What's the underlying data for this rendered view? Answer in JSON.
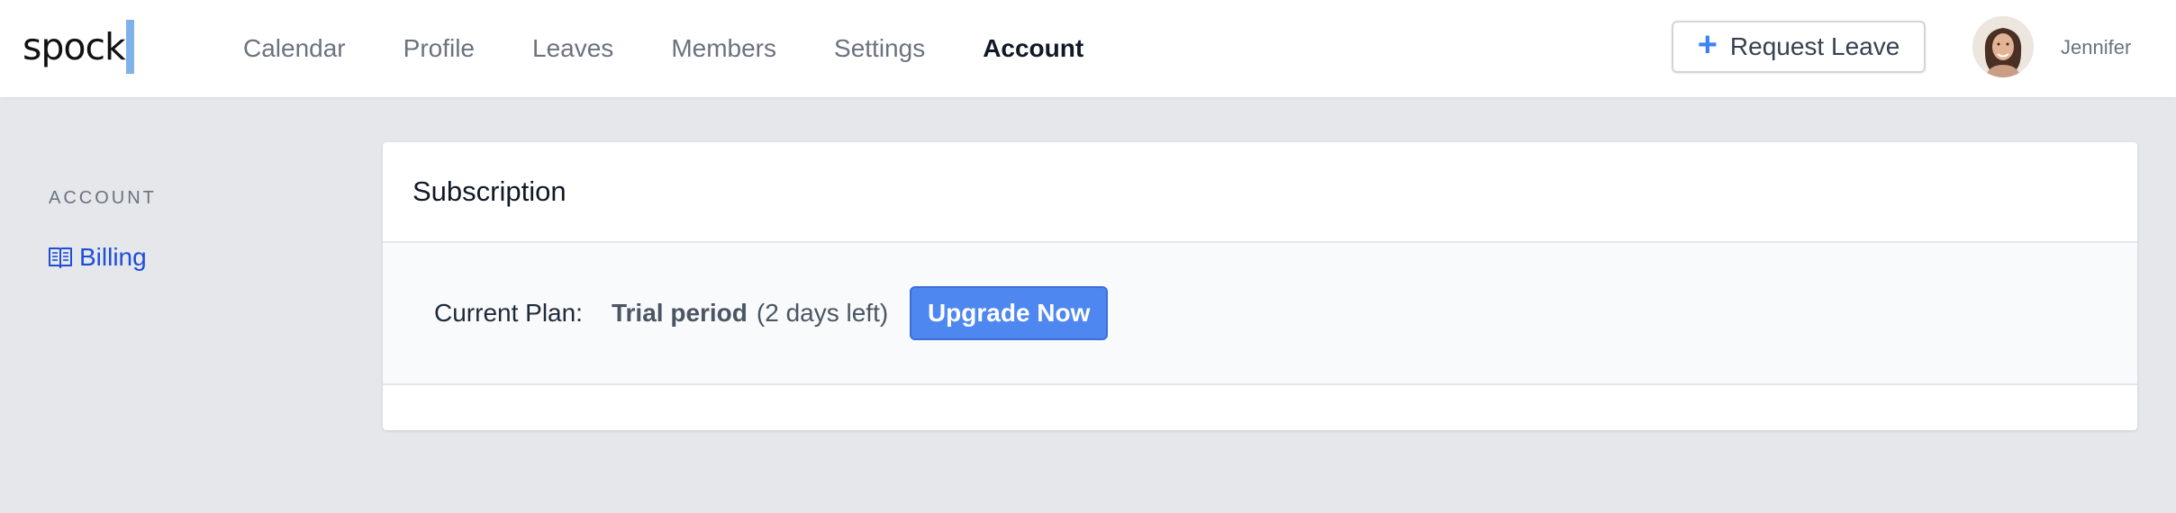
{
  "brand": {
    "name": "spock",
    "accent_color": "#7fb2ea"
  },
  "nav": {
    "items": [
      {
        "label": "Calendar"
      },
      {
        "label": "Profile"
      },
      {
        "label": "Leaves"
      },
      {
        "label": "Members"
      },
      {
        "label": "Settings"
      },
      {
        "label": "Account"
      }
    ],
    "active": "Account"
  },
  "header": {
    "request_leave_label": "Request Leave",
    "plus_icon": "plus-icon",
    "user": {
      "name": "Jennifer",
      "avatar_icon": "avatar-photo"
    }
  },
  "sidebar": {
    "heading": "ACCOUNT",
    "items": [
      {
        "label": "Billing",
        "icon": "book-icon",
        "color": "#1d4ed8"
      }
    ]
  },
  "subscription": {
    "title": "Subscription",
    "current_plan_label": "Current Plan:",
    "plan_name": "Trial period",
    "plan_remaining": "(2 days left)",
    "upgrade_label": "Upgrade Now",
    "upgrade_color": "#4f87f0"
  }
}
